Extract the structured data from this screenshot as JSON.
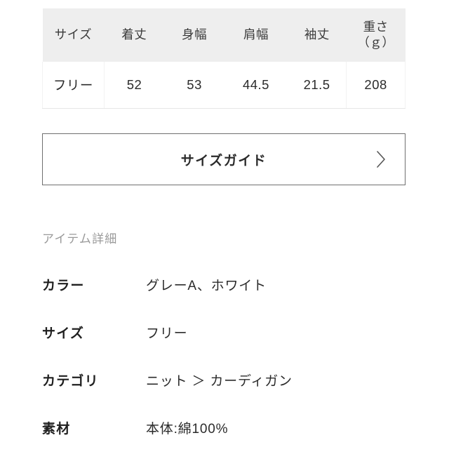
{
  "size_table": {
    "headers": [
      {
        "label": "サイズ"
      },
      {
        "label": "着丈"
      },
      {
        "label": "身幅"
      },
      {
        "label": "肩幅"
      },
      {
        "label": "袖丈"
      },
      {
        "label": "重さ",
        "label_line2": "（ｇ）"
      }
    ],
    "rows": [
      {
        "size": "フリー",
        "length": "52",
        "width": "53",
        "shoulder": "44.5",
        "sleeve": "21.5",
        "weight": "208"
      }
    ]
  },
  "size_guide_button": {
    "label": "サイズガイド",
    "chevron_icon": "chevron-right-icon"
  },
  "item_detail": {
    "heading": "アイテム詳細",
    "rows": [
      {
        "label": "カラー",
        "value": "グレーA、ホワイト"
      },
      {
        "label": "サイズ",
        "value": "フリー"
      },
      {
        "label": "カテゴリ",
        "value": "ニット ＞ カーディガン"
      },
      {
        "label": "素材",
        "value": "本体:綿100%"
      }
    ]
  },
  "colors": {
    "table_header_bg": "#eeeeee",
    "table_border": "#e6e6e6",
    "button_border": "#6f6f6f",
    "heading_text": "#9a9a9a",
    "body_text": "#2b2b2b",
    "page_bg": "#ffffff"
  }
}
